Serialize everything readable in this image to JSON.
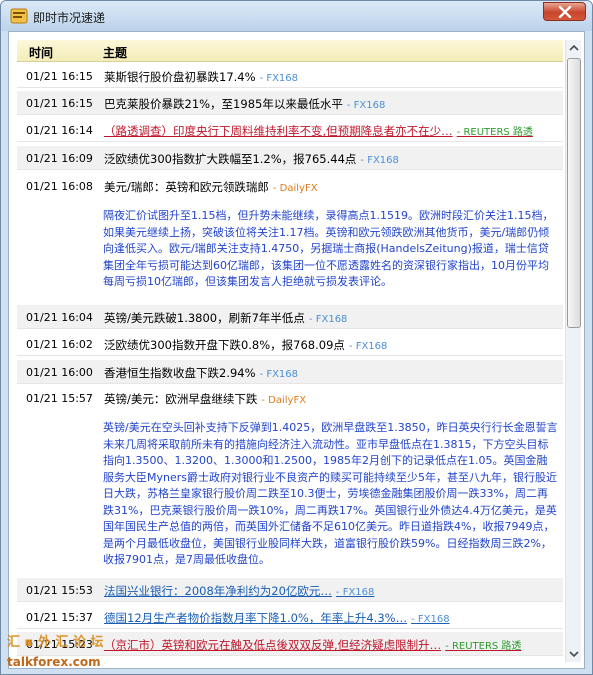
{
  "window": {
    "title": "即时市况速递"
  },
  "header": {
    "time": "时间",
    "topic": "主题"
  },
  "rows": [
    {
      "time": "01/21 16:15",
      "topic": "莱斯银行股价盘初暴跌17.4%",
      "source": "- FX168"
    },
    {
      "time": "01/21 16:15",
      "topic": "巴克莱股价暴跌21%，至1985年以来最低水平",
      "source": "- FX168"
    },
    {
      "time": "01/21 16:14",
      "topic": "（路透调查）印度央行下周料维持利率不变,但预期降息者亦不在少…",
      "source": "- REUTERS 路透"
    },
    {
      "time": "01/21 16:09",
      "topic": "泛欧绩优300指数扩大跌幅至1.2%，报765.44点",
      "source": "- FX168"
    },
    {
      "time": "01/21 16:08",
      "topic": "美元/瑞郎：英镑和欧元领跌瑞郎",
      "source": "- DailyFX"
    },
    {
      "time": "01/21 16:04",
      "topic": "英镑/美元跌破1.3800，刷新7年半低点",
      "source": "- FX168"
    },
    {
      "time": "01/21 16:02",
      "topic": "泛欧绩优300指数开盘下跌0.8%，报768.09点",
      "source": "- FX168"
    },
    {
      "time": "01/21 16:00",
      "topic": "香港恒生指数收盘下跌2.94%",
      "source": "- FX168"
    },
    {
      "time": "01/21 15:57",
      "topic": "英镑/美元：欧洲早盘继续下跌",
      "source": "- DailyFX"
    },
    {
      "time": "01/21 15:53",
      "topic": "法国兴业银行：2008年净利约为20亿欧元…",
      "source": "- FX168"
    },
    {
      "time": "01/21 15:37",
      "topic": "德国12月生产者物价指数月率下降1.0%，年率上升4.3%…",
      "source": "- FX168"
    },
    {
      "time": "01/21 15:23",
      "topic": "（京汇市）英镑和欧元在触及低点後双双反弹,但经济疑虑限制升…",
      "source": "- REUTERS 路透"
    }
  ],
  "details": {
    "chf": "隔夜汇价试图升至1.15档，但升势未能继续，录得高点1.1519。欧洲时段汇价关注1.15档，如果美元继续上扬，突破该位将关注1.17档。英镑和欧元领跌欧洲其他货币，美元/瑞郎仍倾向逢低买入。欧元/瑞郎关注支持1.4750，另据瑞士商报(HandelsZeitung)报道，瑞士信贷集团全年亏损可能达到60亿瑞郎，该集团一位不愿透露姓名的资深银行家指出，10月份平均每周亏损10亿瑞郎，但该集团发言人拒绝就亏损发表评论。",
    "gbp": "英镑/美元在空头回补支持下反弹到1.4025，欧洲早盘跌至1.3850，昨日英央行行长金恩誓言未来几周将采取前所未有的措施向经济注入流动性。亚市早盘低点在1.3815，下方空头目标指向1.3500、1.3200、1.3000和1.2500，1985年2月创下的记录低点在1.05。英国金融服务大臣Myners爵士政府对银行业不良资产的赎买可能持续至少5年，甚至八九年，银行股近日大跌，苏格兰皇家银行股价周二跌至10.3便士，劳埃德金融集团股价周一跌33%，周二再跌31%，巴克莱银行股价周一跌10%，周二再跌17%。英国银行业外债达4.4万亿美元，是英国年国民生产总值的两倍，而英国外汇储备不足610亿美元。昨日道指跌4%，收报7949点，是两个月最低收盘位，美国银行业股同样大跌，道富银行股价跌59%。日经指数周三跌2%，收报7901点，是7周最低收盘位。"
  },
  "watermark": {
    "line1": "汇 ▪ 外 汇 论 坛",
    "line2": "talkforex.com"
  }
}
